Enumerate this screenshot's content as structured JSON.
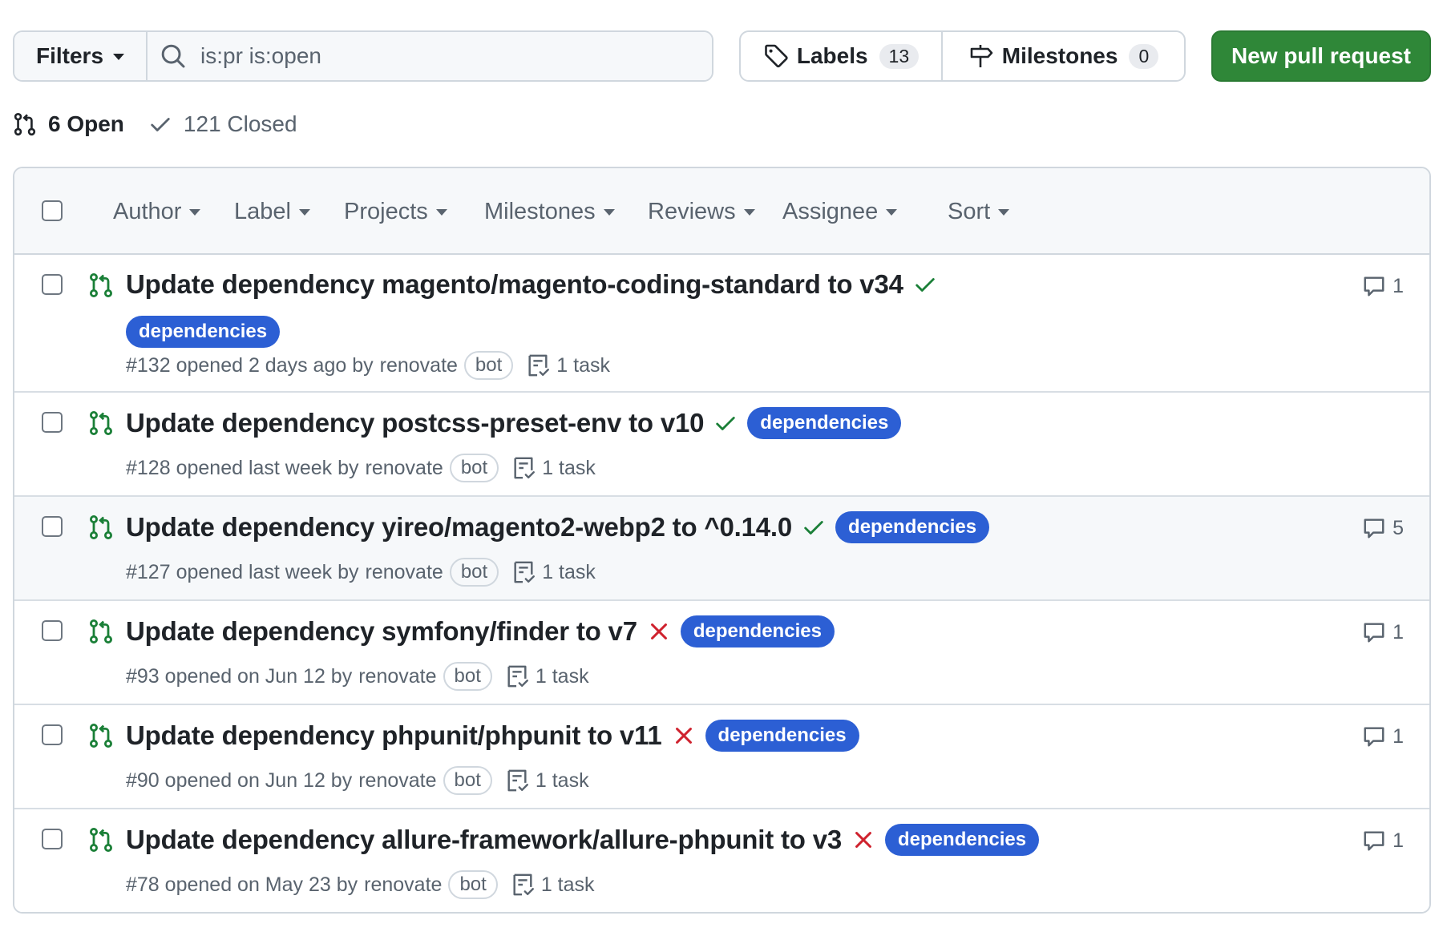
{
  "toolbar": {
    "filters_label": "Filters",
    "search_value": "is:pr is:open",
    "labels_label": "Labels",
    "labels_count": "13",
    "milestones_label": "Milestones",
    "milestones_count": "0",
    "new_pr_label": "New pull request",
    "new_pr_color": "#2f8738"
  },
  "states": {
    "open": "6 Open",
    "closed": "121 Closed"
  },
  "facets": {
    "author": "Author",
    "label": "Label",
    "projects": "Projects",
    "milestones": "Milestones",
    "reviews": "Reviews",
    "assignee": "Assignee",
    "sort": "Sort"
  },
  "pulls": [
    {
      "title": "Update dependency magento/magento-coding-standard to v34",
      "status": "success",
      "label": "dependencies",
      "number": "#132",
      "opened": "opened 2 days ago by",
      "author": "renovate",
      "badge": "bot",
      "tasks": "1 task",
      "comments": "1"
    },
    {
      "title": "Update dependency postcss-preset-env to v10",
      "status": "success",
      "label": "dependencies",
      "number": "#128",
      "opened": "opened last week by",
      "author": "renovate",
      "badge": "bot",
      "tasks": "1 task",
      "comments": ""
    },
    {
      "title": "Update dependency yireo/magento2-webp2 to ^0.14.0",
      "status": "success",
      "label": "dependencies",
      "number": "#127",
      "opened": "opened last week by",
      "author": "renovate",
      "badge": "bot",
      "tasks": "1 task",
      "comments": "5"
    },
    {
      "title": "Update dependency symfony/finder to v7",
      "status": "failure",
      "label": "dependencies",
      "number": "#93",
      "opened": "opened on Jun 12 by",
      "author": "renovate",
      "badge": "bot",
      "tasks": "1 task",
      "comments": "1"
    },
    {
      "title": "Update dependency phpunit/phpunit to v11",
      "status": "failure",
      "label": "dependencies",
      "number": "#90",
      "opened": "opened on Jun 12 by",
      "author": "renovate",
      "badge": "bot",
      "tasks": "1 task",
      "comments": "1"
    },
    {
      "title": "Update dependency allure-framework/allure-phpunit to v3",
      "status": "failure",
      "label": "dependencies",
      "number": "#78",
      "opened": "opened on May 23 by",
      "author": "renovate",
      "badge": "bot",
      "tasks": "1 task",
      "comments": "1"
    }
  ],
  "colors": {
    "label_bg": "#2c5fd4",
    "open_icon": "#1a7f37",
    "success": "#1a7f37",
    "failure": "#cf222e"
  }
}
